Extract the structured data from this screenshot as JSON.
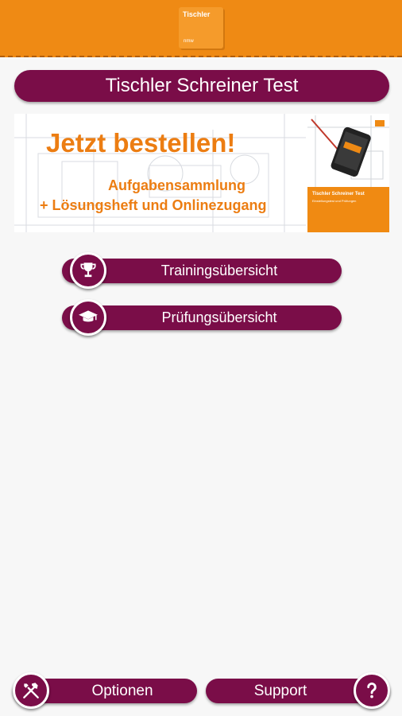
{
  "header": {
    "logo_title": "Tischler",
    "logo_small": "nmw"
  },
  "app": {
    "title": "Tischler Schreiner Test"
  },
  "banner": {
    "headline": "Jetzt bestellen!",
    "line1": "Aufgabensammlung",
    "line2": "+ Lösungsheft und Onlinezugang",
    "book_title": "Tischler Schreiner Test",
    "book_subtitle": "Einstellungstest und Prüfungen",
    "accent_color": "#ec7d12"
  },
  "menu": {
    "training_label": "Trainingsübersicht",
    "training_icon": "trophy-icon",
    "exam_label": "Prüfungsübersicht",
    "exam_icon": "graduation-cap-icon"
  },
  "footer": {
    "options_label": "Optionen",
    "options_icon": "tools-icon",
    "support_label": "Support",
    "support_icon": "question-icon"
  },
  "colors": {
    "header": "#ef8a14",
    "primary": "#7a0d48",
    "background": "#f7f7f7"
  }
}
